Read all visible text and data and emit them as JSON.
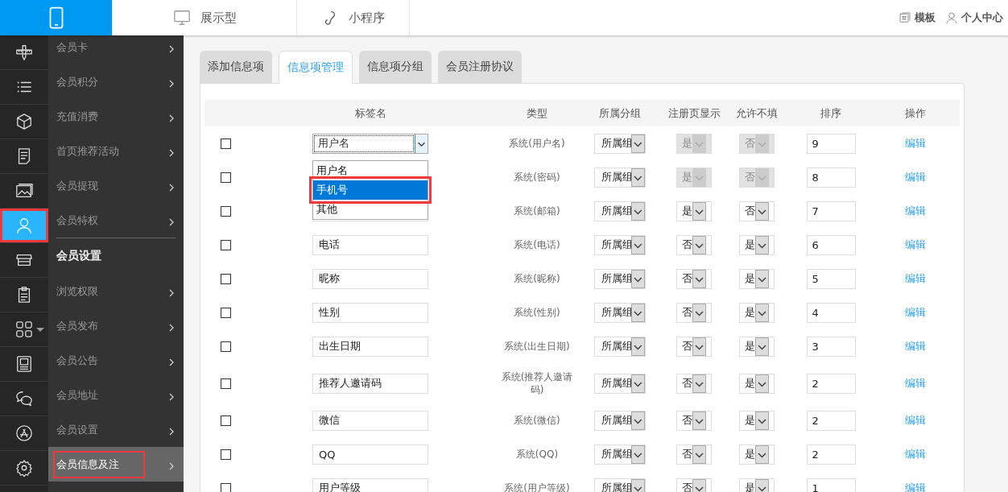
{
  "top_nav": [
    {
      "kind": "phone",
      "selected": true
    },
    {
      "kind": "monitor",
      "label": "展示型",
      "selected": false
    },
    {
      "kind": "link",
      "label": "小程序",
      "selected": false
    }
  ],
  "top_links": [
    {
      "kind": "template",
      "label": "模板"
    },
    {
      "kind": "user",
      "label": "个人中心"
    }
  ],
  "sidebar": {
    "icons": [
      {
        "kind": "tools",
        "selected": false,
        "highlighted": false
      },
      {
        "kind": "list",
        "selected": false,
        "highlighted": false
      },
      {
        "kind": "cube",
        "selected": false,
        "highlighted": false
      },
      {
        "kind": "doc",
        "selected": false,
        "highlighted": false
      },
      {
        "kind": "image",
        "selected": false,
        "highlighted": false
      },
      {
        "kind": "user",
        "selected": true,
        "highlighted": true
      },
      {
        "kind": "store",
        "selected": false,
        "highlighted": false
      },
      {
        "kind": "clipboard",
        "selected": false,
        "highlighted": false
      },
      {
        "kind": "grid",
        "selected": false,
        "highlighted": false
      },
      {
        "kind": "frame",
        "selected": false,
        "highlighted": false
      },
      {
        "kind": "chat",
        "selected": false,
        "highlighted": false
      },
      {
        "kind": "appstore",
        "selected": false,
        "highlighted": false
      },
      {
        "kind": "gear",
        "selected": false,
        "highlighted": false
      }
    ],
    "items": [
      {
        "kind": "link",
        "label": "会员卡",
        "selected": false,
        "highlighted": false
      },
      {
        "kind": "link",
        "label": "会员积分",
        "selected": false,
        "highlighted": false
      },
      {
        "kind": "link",
        "label": "充值消费",
        "selected": false,
        "highlighted": false
      },
      {
        "kind": "link",
        "label": "首页推荐活动",
        "selected": false,
        "highlighted": false
      },
      {
        "kind": "link",
        "label": "会员提现",
        "selected": false,
        "highlighted": false
      },
      {
        "kind": "link",
        "label": "会员特权",
        "selected": false,
        "highlighted": false
      },
      {
        "kind": "divider"
      },
      {
        "kind": "header",
        "label": "会员设置"
      },
      {
        "kind": "link",
        "label": "浏览权限",
        "selected": false,
        "highlighted": false
      },
      {
        "kind": "link",
        "label": "会员发布",
        "selected": false,
        "highlighted": false
      },
      {
        "kind": "link",
        "label": "会员公告",
        "selected": false,
        "highlighted": false
      },
      {
        "kind": "link",
        "label": "会员地址",
        "selected": false,
        "highlighted": false
      },
      {
        "kind": "link",
        "label": "会员设置",
        "selected": false,
        "highlighted": false
      },
      {
        "kind": "link",
        "label": "会员信息及注",
        "selected": true,
        "highlighted": true
      }
    ]
  },
  "tabs": [
    {
      "label": "添加信息项",
      "selected": false
    },
    {
      "label": "信息项管理",
      "selected": true
    },
    {
      "label": "信息项分组",
      "selected": false
    },
    {
      "label": "会员注册协议",
      "selected": false
    }
  ],
  "table": {
    "columns": [
      "标签名",
      "类型",
      "所属分组",
      "注册页显示",
      "允许不填",
      "排序",
      "操作"
    ],
    "rows": [
      {
        "checked": false,
        "kind": "select",
        "label": "用户名",
        "type": "系统(用户名)",
        "group": "所属组",
        "show": "是",
        "allow_empty": "否",
        "locked": true,
        "sort": "9",
        "action": "编辑"
      },
      {
        "checked": false,
        "kind": "covered",
        "type": "系统(密码)",
        "group": "所属组",
        "show": "是",
        "allow_empty": "否",
        "locked": true,
        "sort": "8",
        "action": "编辑"
      },
      {
        "checked": false,
        "kind": "input",
        "type": "系统(邮箱)",
        "group": "所属组",
        "show": "是",
        "allow_empty": "否",
        "locked": false,
        "sort": "7",
        "action": "编辑"
      },
      {
        "checked": false,
        "kind": "input",
        "label": "电话",
        "type": "系统(电话)",
        "group": "所属组",
        "show": "否",
        "allow_empty": "是",
        "locked": false,
        "sort": "6",
        "action": "编辑"
      },
      {
        "checked": false,
        "kind": "input",
        "label": "昵称",
        "type": "系统(昵称)",
        "group": "所属组",
        "show": "否",
        "allow_empty": "是",
        "locked": false,
        "sort": "5",
        "action": "编辑"
      },
      {
        "checked": false,
        "kind": "input",
        "label": "性别",
        "type": "系统(性别)",
        "group": "所属组",
        "show": "否",
        "allow_empty": "是",
        "locked": false,
        "sort": "4",
        "action": "编辑"
      },
      {
        "checked": false,
        "kind": "input",
        "label": "出生日期",
        "type": "系统(出生日期)",
        "group": "所属组",
        "show": "否",
        "allow_empty": "是",
        "locked": false,
        "sort": "3",
        "action": "编辑"
      },
      {
        "checked": false,
        "kind": "input",
        "label": "推荐人邀请码",
        "type": "系统(推荐人邀请码)",
        "group": "所属组",
        "show": "否",
        "allow_empty": "是",
        "locked": false,
        "sort": "2",
        "action": "编辑"
      },
      {
        "checked": false,
        "kind": "input",
        "label": "微信",
        "type": "系统(微信)",
        "group": "所属组",
        "show": "否",
        "allow_empty": "是",
        "locked": false,
        "sort": "2",
        "action": "编辑"
      },
      {
        "checked": false,
        "kind": "input",
        "label": "QQ",
        "type": "系统(QQ)",
        "group": "所属组",
        "show": "否",
        "allow_empty": "是",
        "locked": false,
        "sort": "2",
        "action": "编辑"
      },
      {
        "checked": false,
        "kind": "input",
        "label": "用户等级",
        "type": "系统(用户等级)",
        "group": "所属组",
        "show": "否",
        "allow_empty": "是",
        "locked": false,
        "sort": "1",
        "action": "编辑"
      }
    ]
  },
  "dropdown": {
    "options": [
      {
        "label": "用户名",
        "selected": false,
        "highlighted": false
      },
      {
        "label": "手机号",
        "selected": true,
        "highlighted": true
      },
      {
        "label": "其他",
        "selected": false,
        "highlighted": false
      }
    ]
  }
}
